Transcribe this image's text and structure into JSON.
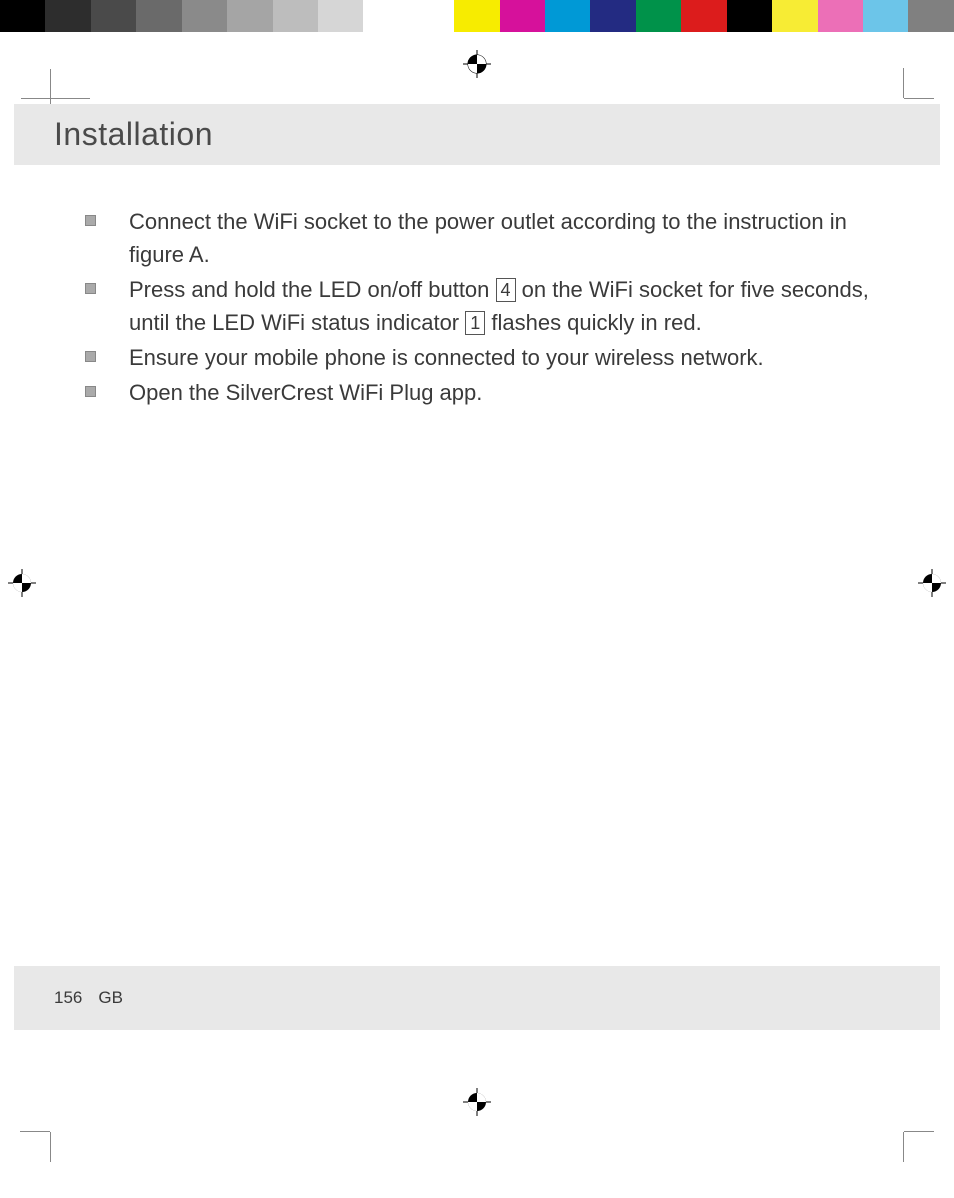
{
  "colorbar": [
    "#000000",
    "#2d2d2d",
    "#4a4a4a",
    "#6a6a6a",
    "#8a8a8a",
    "#a5a5a5",
    "#bdbdbd",
    "#d6d6d6",
    "#ffffff",
    "#ffffff",
    "#f7ec00",
    "#d6119b",
    "#0099d6",
    "#232b82",
    "#00924a",
    "#dc1c1c",
    "#000000",
    "#f7ec34",
    "#ec6fb7",
    "#6cc5e9",
    "#808080"
  ],
  "heading": "Installation",
  "items": [
    {
      "text_before": "Connect the WiFi socket to the power outlet according to the instruction in figure A.",
      "ref": null,
      "text_mid": "",
      "ref2": null,
      "text_after": ""
    },
    {
      "text_before": "Press and hold the LED on/off button ",
      "ref": "4",
      "text_mid": " on the WiFi socket for five seconds, until the LED WiFi status indicator ",
      "ref2": "1",
      "text_after": " flashes quickly in red."
    },
    {
      "text_before": "Ensure your mobile phone is connected to your wireless network.",
      "ref": null,
      "text_mid": "",
      "ref2": null,
      "text_after": ""
    },
    {
      "text_before": "Open the SilverCrest WiFi Plug app.",
      "ref": null,
      "text_mid": "",
      "ref2": null,
      "text_after": ""
    }
  ],
  "footer": {
    "page": "156",
    "lang": "GB"
  }
}
